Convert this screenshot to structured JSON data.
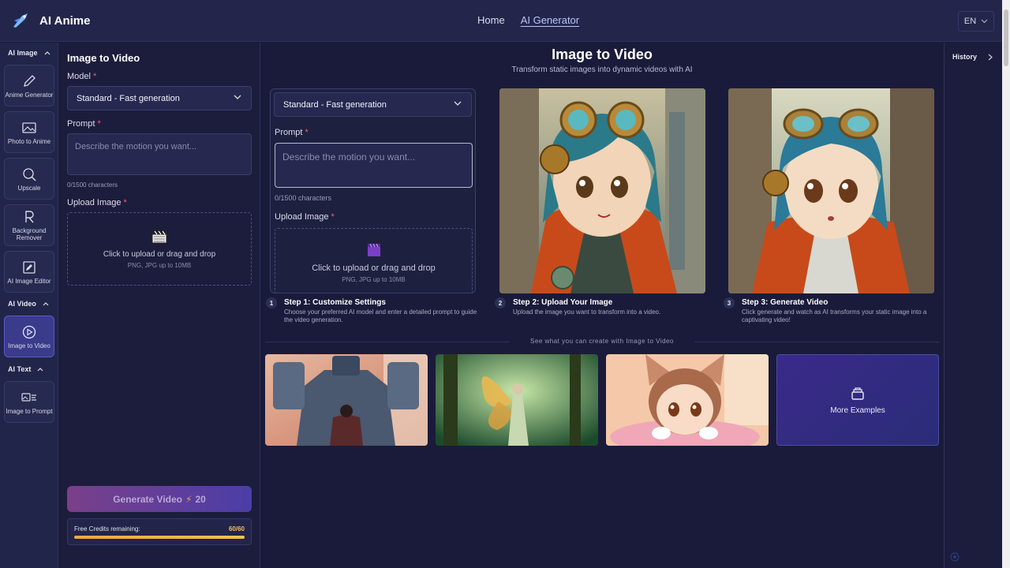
{
  "header": {
    "app_name": "AI Anime",
    "nav": [
      {
        "label": "Home",
        "active": false
      },
      {
        "label": "AI Generator",
        "active": true
      }
    ],
    "language": "EN"
  },
  "rail": {
    "groups": [
      {
        "label": "AI Image",
        "items": [
          {
            "label": "Anime Generator",
            "icon": "pencil-icon"
          },
          {
            "label": "Photo to Anime",
            "icon": "image-icon"
          },
          {
            "label": "Upscale",
            "icon": "magnify-icon"
          },
          {
            "label": "Background Remover",
            "icon": "letter-r-icon"
          },
          {
            "label": "AI Image Editor",
            "icon": "edit-square-icon"
          }
        ]
      },
      {
        "label": "AI Video",
        "items": [
          {
            "label": "Image to Video",
            "icon": "play-circle-icon",
            "active": true
          }
        ]
      },
      {
        "label": "AI Text",
        "items": [
          {
            "label": "Image to Prompt",
            "icon": "image-text-icon"
          }
        ]
      }
    ]
  },
  "panel": {
    "title": "Image to Video",
    "model_label": "Model",
    "model_value": "Standard - Fast generation",
    "prompt_label": "Prompt",
    "prompt_placeholder": "Describe the motion you want...",
    "char_count": "0/1500 characters",
    "upload_label": "Upload Image",
    "upload_main": "Click to upload or drag and drop",
    "upload_sub": "PNG, JPG up to 10MB",
    "generate_label": "Generate Video",
    "generate_cost": "20",
    "credits_label": "Free Credits remaining:",
    "credits_value": "60/60",
    "credits_fraction": 1.0
  },
  "main": {
    "title": "Image to Video",
    "subtitle": "Transform static images into dynamic videos with AI",
    "demo": {
      "model_value": "Standard - Fast generation",
      "prompt_label": "Prompt",
      "prompt_placeholder": "Describe the motion you want...",
      "char_count": "0/1500 characters",
      "upload_label": "Upload Image",
      "upload_main": "Click to upload or drag and drop",
      "upload_sub": "PNG, JPG up to 10MB"
    },
    "steps": [
      {
        "num": "1",
        "title": "Step 1: Customize Settings",
        "desc": "Choose your preferred AI model and enter a detailed prompt to guide the video generation."
      },
      {
        "num": "2",
        "title": "Step 2: Upload Your Image",
        "desc": "Upload the image you want to transform into a video."
      },
      {
        "num": "3",
        "title": "Step 3: Generate Video",
        "desc": "Click generate and watch as AI transforms your static image into a captivating video!"
      }
    ],
    "examples_heading": "See what you can create with Image to Video",
    "more_examples": "More Examples"
  },
  "history": {
    "label": "History"
  },
  "colors": {
    "accent": "#5a5cc8",
    "background": "#1a1b3a",
    "credits": "#f2c14a"
  }
}
